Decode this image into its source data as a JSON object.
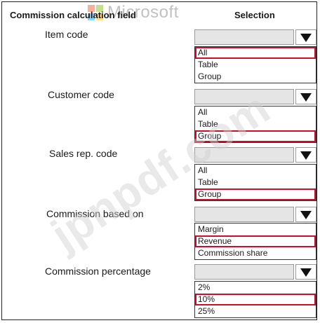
{
  "header": {
    "field_col": "Commission calculation field",
    "selection_col": "Selection"
  },
  "brand": {
    "name": "Microsoft",
    "colors": [
      "#f25022",
      "#7fba00",
      "#00a4ef",
      "#ffb900"
    ]
  },
  "watermark": "jpnpdf.com",
  "accent_color": "#c8102e",
  "fields": [
    {
      "label": "Item code",
      "options": [
        "All",
        "Table",
        "Group"
      ],
      "selected": "All"
    },
    {
      "label": "Customer code",
      "options": [
        "All",
        "Table",
        "Group"
      ],
      "selected": "Group"
    },
    {
      "label": "Sales rep. code",
      "options": [
        "All",
        "Table",
        "Group"
      ],
      "selected": "Group"
    },
    {
      "label": "Commission based on",
      "options": [
        "Margin",
        "Revenue",
        "Commission share"
      ],
      "selected": "Revenue"
    },
    {
      "label": "Commission percentage",
      "options": [
        "2%",
        "10%",
        "25%"
      ],
      "selected": "10%"
    }
  ]
}
